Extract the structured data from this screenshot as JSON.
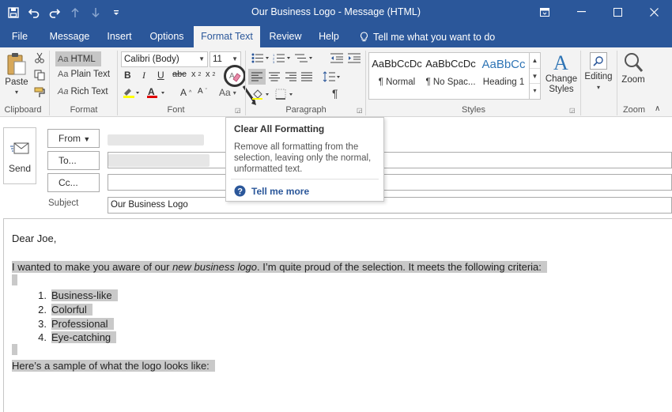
{
  "window": {
    "title": "Our Business Logo  -  Message (HTML)"
  },
  "tabs": [
    {
      "label": "File"
    },
    {
      "label": "Message"
    },
    {
      "label": "Insert"
    },
    {
      "label": "Options"
    },
    {
      "label": "Format Text"
    },
    {
      "label": "Review"
    },
    {
      "label": "Help"
    }
  ],
  "tell_me": "Tell me what you want to do",
  "ribbon": {
    "clipboard": {
      "paste": "Paste",
      "label": "Clipboard"
    },
    "format": {
      "html": "HTML",
      "plain": "Plain Text",
      "rich": "Rich Text",
      "label": "Format"
    },
    "font": {
      "family": "Calibri (Body)",
      "size": "11",
      "label": "Font"
    },
    "paragraph": {
      "label": "Paragraph"
    },
    "styles": {
      "items": [
        {
          "sample": "AaBbCcDc",
          "name": "¶ Normal"
        },
        {
          "sample": "AaBbCcDc",
          "name": "¶ No Spac..."
        },
        {
          "sample": "AaBbCc",
          "name": "Heading 1"
        }
      ],
      "change": "Change Styles",
      "label": "Styles"
    },
    "editing": {
      "label": "Editing"
    },
    "zoom": {
      "button": "Zoom",
      "label": "Zoom"
    }
  },
  "tooltip": {
    "title": "Clear All Formatting",
    "body": "Remove all formatting from the selection, leaving only the normal, unformatted text.",
    "more": "Tell me more"
  },
  "compose": {
    "send": "Send",
    "from": "From",
    "to": "To...",
    "cc": "Cc...",
    "subject_label": "Subject",
    "subject": "Our Business Logo"
  },
  "message": {
    "greeting": "Dear Joe,",
    "p1_a": "I wanted to make you aware of our ",
    "p1_em": "new business logo",
    "p1_b": ". I’m quite proud of the selection. It meets the following criteria:",
    "list": [
      {
        "num": "1.",
        "text": "Business-like"
      },
      {
        "num": "2.",
        "text": "Colorful"
      },
      {
        "num": "3.",
        "text": "Professional"
      },
      {
        "num": "4.",
        "text": "Eye-catching"
      }
    ],
    "p2": "Here’s a sample of what the logo looks like:"
  },
  "colors": {
    "accent": "#2b579a",
    "highlight": "#c9c9c9",
    "ribbon_bg": "#f3f3f3"
  }
}
